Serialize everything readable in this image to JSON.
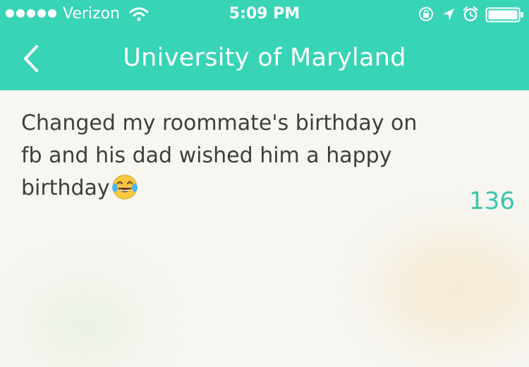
{
  "status_bar": {
    "carrier": "Verizon",
    "time": "5:09 PM",
    "signal_icon": "signal-dots-icon",
    "wifi_icon": "wifi-icon",
    "lock_icon": "rotation-lock-icon",
    "location_icon": "location-arrow-icon",
    "alarm_icon": "alarm-clock-icon",
    "battery_icon": "battery-icon"
  },
  "nav": {
    "title": "University of Maryland",
    "back_icon": "chevron-left-icon"
  },
  "post": {
    "text": "Changed my roommate's birthday on fb and his dad wished him a happy birthday",
    "emoji": "face-with-tears-of-joy-icon",
    "votes": "136"
  },
  "colors": {
    "accent": "#37d4b6",
    "vote": "#37c6ad",
    "text": "#3e3e3e"
  }
}
